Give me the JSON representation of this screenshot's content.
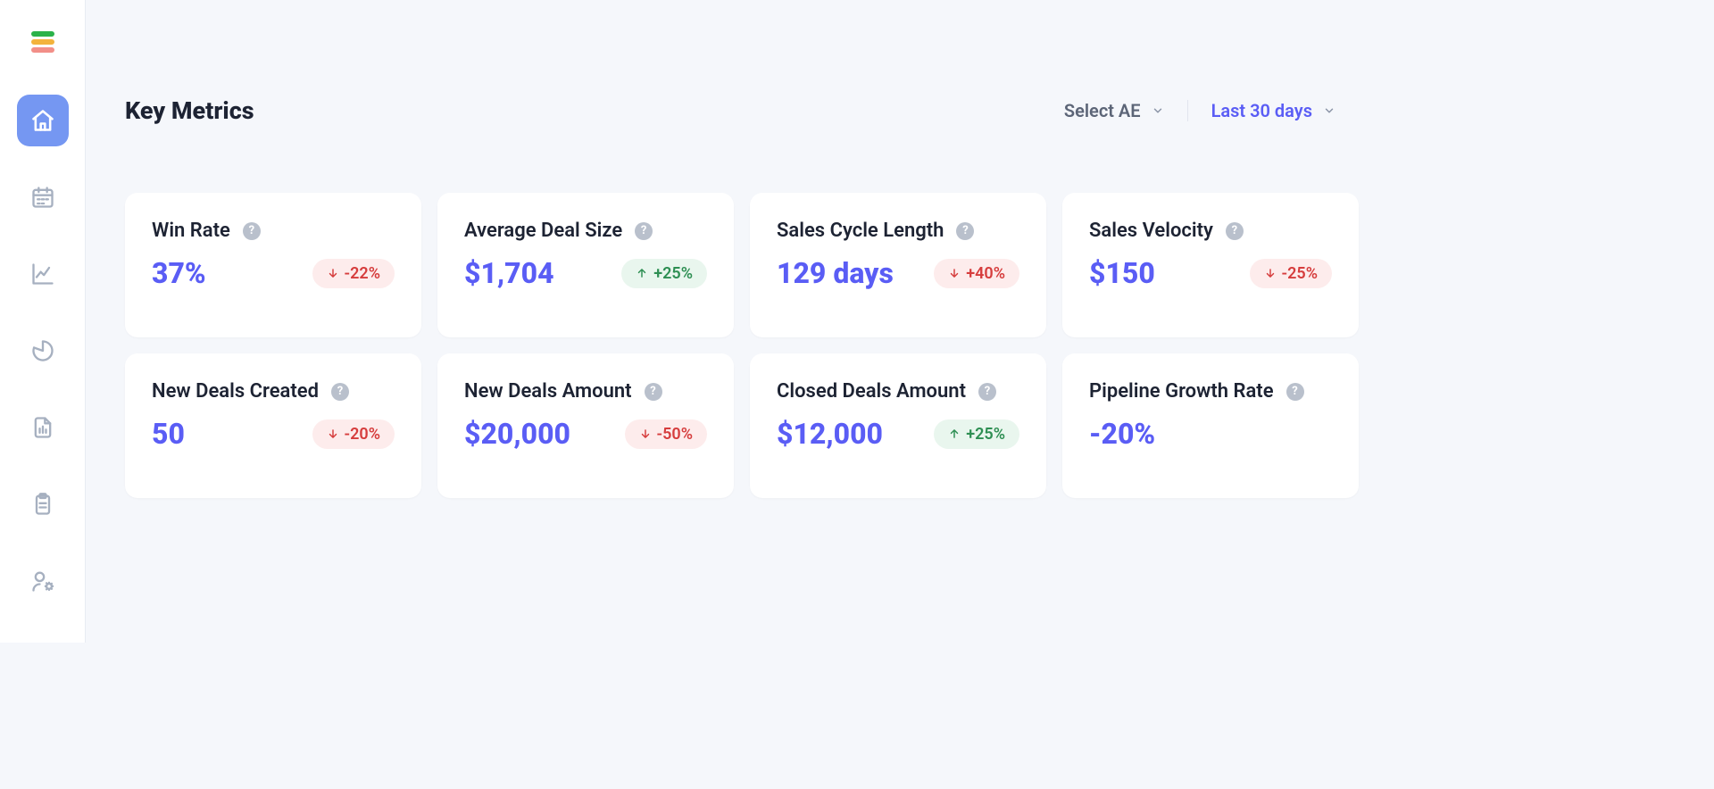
{
  "header": {
    "title": "Key Metrics",
    "ae_filter_label": "Select AE",
    "range_filter_label": "Last 30 days"
  },
  "sidebar": {
    "items": [
      {
        "name": "home",
        "active": true
      },
      {
        "name": "calendar",
        "active": false
      },
      {
        "name": "trends",
        "active": false
      },
      {
        "name": "pie",
        "active": false
      },
      {
        "name": "bar-report",
        "active": false
      },
      {
        "name": "clipboard",
        "active": false
      },
      {
        "name": "user-settings",
        "active": false
      }
    ]
  },
  "metrics": [
    {
      "title": "Win Rate",
      "value": "37%",
      "delta": "-22%",
      "direction": "down"
    },
    {
      "title": "Average Deal Size",
      "value": "$1,704",
      "delta": "+25%",
      "direction": "up"
    },
    {
      "title": "Sales Cycle Length",
      "value": "129 days",
      "delta": "+40%",
      "direction": "down"
    },
    {
      "title": "Sales Velocity",
      "value": "$150",
      "delta": "-25%",
      "direction": "down"
    },
    {
      "title": "New Deals Created",
      "value": "50",
      "delta": "-20%",
      "direction": "down"
    },
    {
      "title": "New Deals Amount",
      "value": "$20,000",
      "delta": "-50%",
      "direction": "down"
    },
    {
      "title": "Closed Deals Amount",
      "value": "$12,000",
      "delta": "+25%",
      "direction": "up"
    },
    {
      "title": "Pipeline Growth Rate",
      "value": "-20%",
      "delta": null,
      "direction": null
    }
  ],
  "colors": {
    "accent": "#5a5df5",
    "nav_active": "#7597f2",
    "delta_down_bg": "#fdecec",
    "delta_down_fg": "#d63d3d",
    "delta_up_bg": "#e9f6ee",
    "delta_up_fg": "#2e8f53"
  }
}
